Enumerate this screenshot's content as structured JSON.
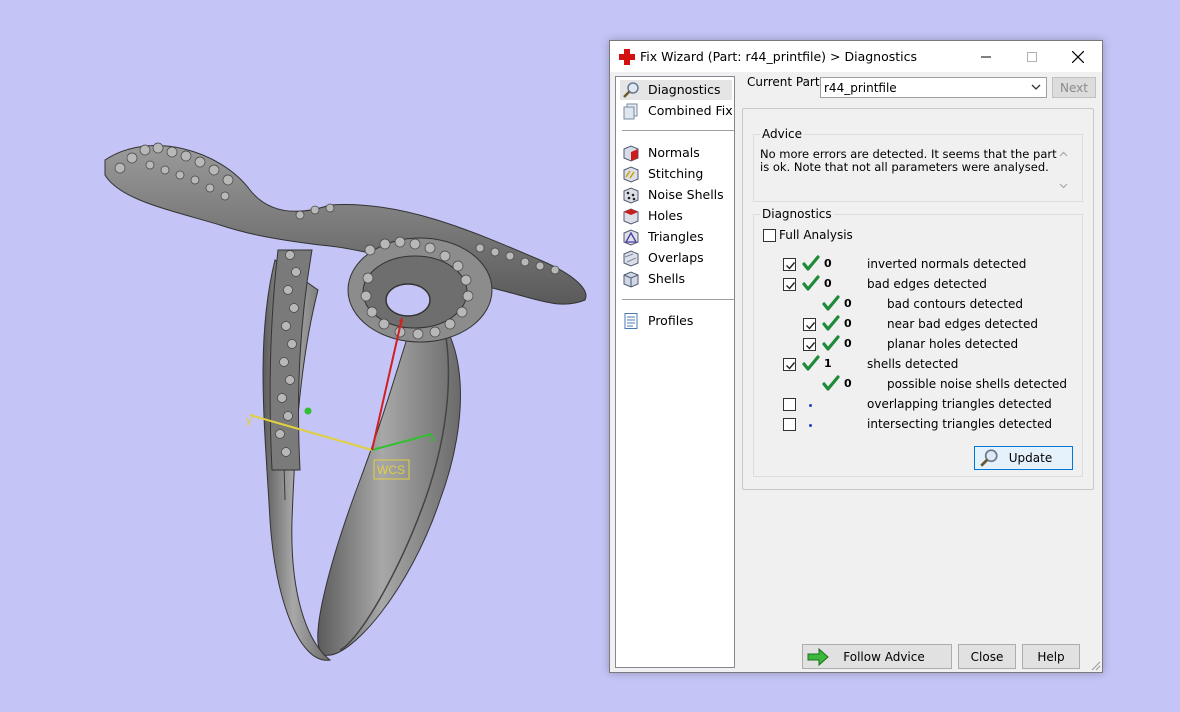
{
  "viewport": {
    "wcs_label": "WCS",
    "axis_x": "x",
    "axis_y": "y",
    "axis_z": "z"
  },
  "window": {
    "title": "Fix Wizard (Part: r44_printfile) > Diagnostics",
    "app_icon": "red-cross-icon"
  },
  "nav": {
    "groups": [
      [
        {
          "label": "Diagnostics",
          "icon": "magnifier-icon",
          "selected": true
        },
        {
          "label": "Combined Fix",
          "icon": "combined-fix-icon"
        }
      ],
      [
        {
          "label": "Normals",
          "icon": "normals-icon"
        },
        {
          "label": "Stitching",
          "icon": "stitching-icon"
        },
        {
          "label": "Noise Shells",
          "icon": "noise-shells-icon"
        },
        {
          "label": "Holes",
          "icon": "holes-icon"
        },
        {
          "label": "Triangles",
          "icon": "triangles-icon"
        },
        {
          "label": "Overlaps",
          "icon": "overlaps-icon"
        },
        {
          "label": "Shells",
          "icon": "shells-icon"
        }
      ],
      [
        {
          "label": "Profiles",
          "icon": "document-icon"
        }
      ]
    ]
  },
  "current_part": {
    "label": "Current Part:",
    "value": "r44_printfile",
    "next_label": "Next"
  },
  "advice": {
    "legend": "Advice",
    "text": "No more errors are detected. It seems that the part is ok. Note that not all parameters were analysed."
  },
  "diagnostics": {
    "legend": "Diagnostics",
    "full_analysis_label": "Full Analysis",
    "full_analysis_checked": false,
    "rows": [
      {
        "level": 0,
        "checkbox": true,
        "checked": true,
        "status": "ok",
        "count": "0",
        "label": "inverted normals detected"
      },
      {
        "level": 0,
        "checkbox": true,
        "checked": true,
        "status": "ok",
        "count": "0",
        "label": "bad edges detected"
      },
      {
        "level": 1,
        "checkbox": false,
        "checked": false,
        "status": "ok",
        "count": "0",
        "label": "bad contours detected"
      },
      {
        "level": 1,
        "checkbox": true,
        "checked": true,
        "status": "ok",
        "count": "0",
        "label": "near bad edges detected"
      },
      {
        "level": 1,
        "checkbox": true,
        "checked": true,
        "status": "ok",
        "count": "0",
        "label": "planar holes detected"
      },
      {
        "level": 0,
        "checkbox": true,
        "checked": true,
        "status": "ok",
        "count": "1",
        "label": "shells detected"
      },
      {
        "level": 1,
        "checkbox": false,
        "checked": false,
        "status": "ok",
        "count": "0",
        "label": "possible noise shells detected"
      },
      {
        "level": 0,
        "checkbox": true,
        "checked": false,
        "status": "pending",
        "count": "",
        "label": "overlapping triangles detected"
      },
      {
        "level": 0,
        "checkbox": true,
        "checked": false,
        "status": "pending",
        "count": "",
        "label": "intersecting triangles detected"
      }
    ],
    "update_label": "Update"
  },
  "footer": {
    "follow_advice_label": "Follow Advice",
    "close_label": "Close",
    "help_label": "Help"
  },
  "colors": {
    "desktop": "#c4c4f6",
    "ok_check": "#1f8a3a",
    "ring": "#8a8a8a"
  }
}
